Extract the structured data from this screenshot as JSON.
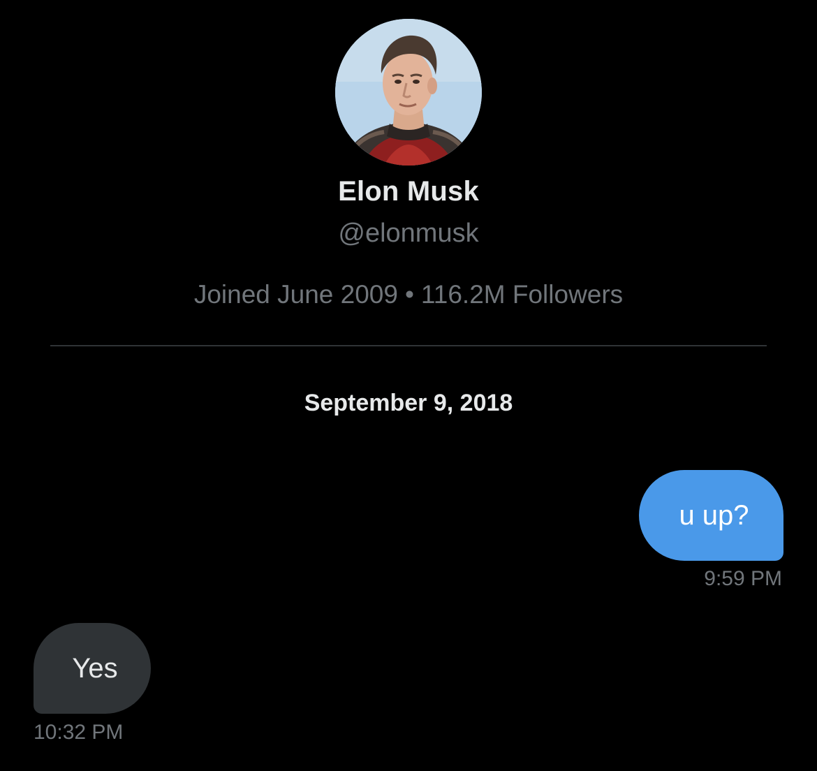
{
  "profile": {
    "display_name": "Elon Musk",
    "handle": "@elonmusk",
    "joined": "Joined June 2009",
    "separator": "•",
    "followers": "116.2M Followers",
    "avatar_icon": "profile-photo"
  },
  "conversation": {
    "date": "September 9, 2018",
    "messages": [
      {
        "direction": "sent",
        "text": "u up?",
        "time": "9:59 PM"
      },
      {
        "direction": "received",
        "text": "Yes",
        "time": "10:32 PM"
      }
    ]
  },
  "colors": {
    "background": "#000000",
    "sent_bubble": "#4a99e9",
    "received_bubble": "#2f3336",
    "secondary_text": "#71767b",
    "primary_text": "#e7e9ea"
  }
}
